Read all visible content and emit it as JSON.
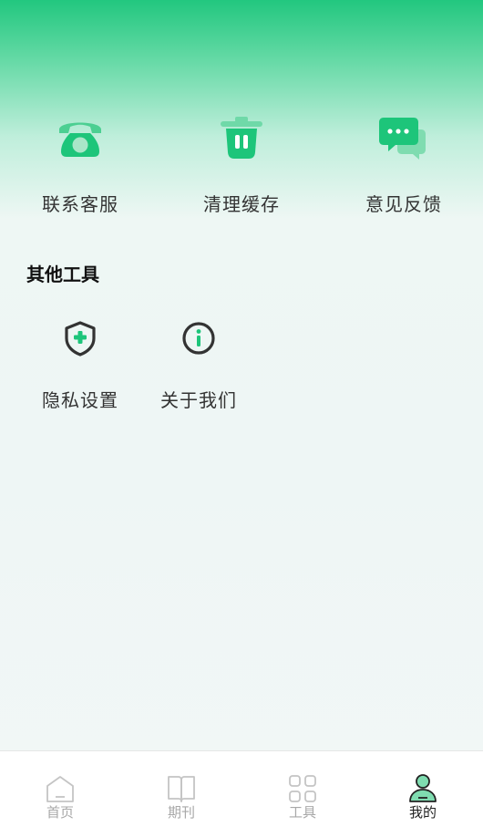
{
  "quick_actions": [
    {
      "label": "联系客服",
      "icon": "telephone-icon"
    },
    {
      "label": "清理缓存",
      "icon": "trash-icon"
    },
    {
      "label": "意见反馈",
      "icon": "chat-bubbles-icon"
    }
  ],
  "other_tools": {
    "title": "其他工具",
    "items": [
      {
        "label": "隐私设置",
        "icon": "shield-plus-icon"
      },
      {
        "label": "关于我们",
        "icon": "info-circle-icon"
      }
    ]
  },
  "tabbar": {
    "items": [
      {
        "label": "首页",
        "icon": "home-icon",
        "active": false
      },
      {
        "label": "期刊",
        "icon": "book-icon",
        "active": false
      },
      {
        "label": "工具",
        "icon": "grid-icon",
        "active": false
      },
      {
        "label": "我的",
        "icon": "user-icon",
        "active": true
      }
    ]
  },
  "colors": {
    "accent": "#1dc57a",
    "accent_light": "#6fd9a8",
    "text": "#333333",
    "tab_inactive": "#a8a8a8"
  }
}
